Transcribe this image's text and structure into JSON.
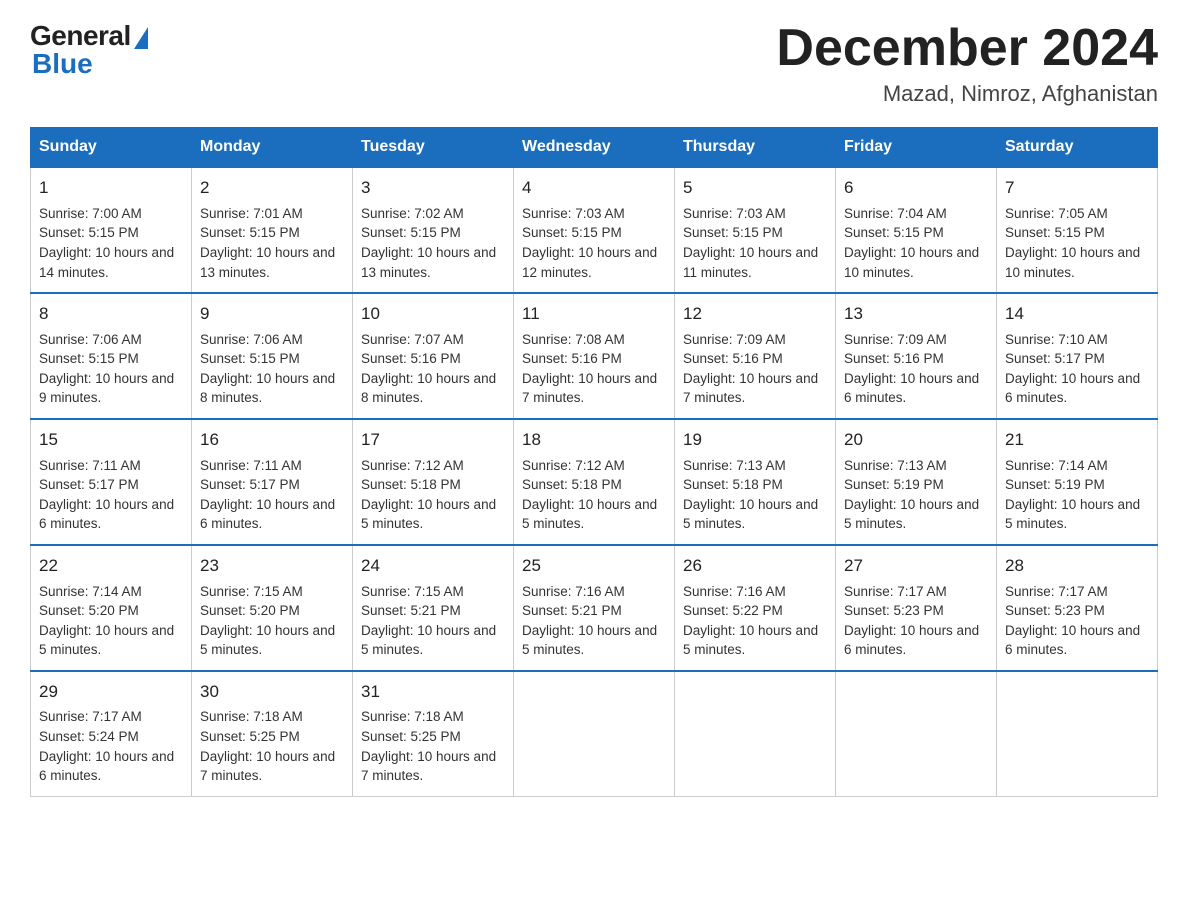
{
  "header": {
    "logo_general": "General",
    "logo_blue": "Blue",
    "title": "December 2024",
    "location": "Mazad, Nimroz, Afghanistan"
  },
  "days_of_week": [
    "Sunday",
    "Monday",
    "Tuesday",
    "Wednesday",
    "Thursday",
    "Friday",
    "Saturday"
  ],
  "weeks": [
    [
      {
        "day": "1",
        "sunrise": "7:00 AM",
        "sunset": "5:15 PM",
        "daylight": "10 hours and 14 minutes."
      },
      {
        "day": "2",
        "sunrise": "7:01 AM",
        "sunset": "5:15 PM",
        "daylight": "10 hours and 13 minutes."
      },
      {
        "day": "3",
        "sunrise": "7:02 AM",
        "sunset": "5:15 PM",
        "daylight": "10 hours and 13 minutes."
      },
      {
        "day": "4",
        "sunrise": "7:03 AM",
        "sunset": "5:15 PM",
        "daylight": "10 hours and 12 minutes."
      },
      {
        "day": "5",
        "sunrise": "7:03 AM",
        "sunset": "5:15 PM",
        "daylight": "10 hours and 11 minutes."
      },
      {
        "day": "6",
        "sunrise": "7:04 AM",
        "sunset": "5:15 PM",
        "daylight": "10 hours and 10 minutes."
      },
      {
        "day": "7",
        "sunrise": "7:05 AM",
        "sunset": "5:15 PM",
        "daylight": "10 hours and 10 minutes."
      }
    ],
    [
      {
        "day": "8",
        "sunrise": "7:06 AM",
        "sunset": "5:15 PM",
        "daylight": "10 hours and 9 minutes."
      },
      {
        "day": "9",
        "sunrise": "7:06 AM",
        "sunset": "5:15 PM",
        "daylight": "10 hours and 8 minutes."
      },
      {
        "day": "10",
        "sunrise": "7:07 AM",
        "sunset": "5:16 PM",
        "daylight": "10 hours and 8 minutes."
      },
      {
        "day": "11",
        "sunrise": "7:08 AM",
        "sunset": "5:16 PM",
        "daylight": "10 hours and 7 minutes."
      },
      {
        "day": "12",
        "sunrise": "7:09 AM",
        "sunset": "5:16 PM",
        "daylight": "10 hours and 7 minutes."
      },
      {
        "day": "13",
        "sunrise": "7:09 AM",
        "sunset": "5:16 PM",
        "daylight": "10 hours and 6 minutes."
      },
      {
        "day": "14",
        "sunrise": "7:10 AM",
        "sunset": "5:17 PM",
        "daylight": "10 hours and 6 minutes."
      }
    ],
    [
      {
        "day": "15",
        "sunrise": "7:11 AM",
        "sunset": "5:17 PM",
        "daylight": "10 hours and 6 minutes."
      },
      {
        "day": "16",
        "sunrise": "7:11 AM",
        "sunset": "5:17 PM",
        "daylight": "10 hours and 6 minutes."
      },
      {
        "day": "17",
        "sunrise": "7:12 AM",
        "sunset": "5:18 PM",
        "daylight": "10 hours and 5 minutes."
      },
      {
        "day": "18",
        "sunrise": "7:12 AM",
        "sunset": "5:18 PM",
        "daylight": "10 hours and 5 minutes."
      },
      {
        "day": "19",
        "sunrise": "7:13 AM",
        "sunset": "5:18 PM",
        "daylight": "10 hours and 5 minutes."
      },
      {
        "day": "20",
        "sunrise": "7:13 AM",
        "sunset": "5:19 PM",
        "daylight": "10 hours and 5 minutes."
      },
      {
        "day": "21",
        "sunrise": "7:14 AM",
        "sunset": "5:19 PM",
        "daylight": "10 hours and 5 minutes."
      }
    ],
    [
      {
        "day": "22",
        "sunrise": "7:14 AM",
        "sunset": "5:20 PM",
        "daylight": "10 hours and 5 minutes."
      },
      {
        "day": "23",
        "sunrise": "7:15 AM",
        "sunset": "5:20 PM",
        "daylight": "10 hours and 5 minutes."
      },
      {
        "day": "24",
        "sunrise": "7:15 AM",
        "sunset": "5:21 PM",
        "daylight": "10 hours and 5 minutes."
      },
      {
        "day": "25",
        "sunrise": "7:16 AM",
        "sunset": "5:21 PM",
        "daylight": "10 hours and 5 minutes."
      },
      {
        "day": "26",
        "sunrise": "7:16 AM",
        "sunset": "5:22 PM",
        "daylight": "10 hours and 5 minutes."
      },
      {
        "day": "27",
        "sunrise": "7:17 AM",
        "sunset": "5:23 PM",
        "daylight": "10 hours and 6 minutes."
      },
      {
        "day": "28",
        "sunrise": "7:17 AM",
        "sunset": "5:23 PM",
        "daylight": "10 hours and 6 minutes."
      }
    ],
    [
      {
        "day": "29",
        "sunrise": "7:17 AM",
        "sunset": "5:24 PM",
        "daylight": "10 hours and 6 minutes."
      },
      {
        "day": "30",
        "sunrise": "7:18 AM",
        "sunset": "5:25 PM",
        "daylight": "10 hours and 7 minutes."
      },
      {
        "day": "31",
        "sunrise": "7:18 AM",
        "sunset": "5:25 PM",
        "daylight": "10 hours and 7 minutes."
      },
      null,
      null,
      null,
      null
    ]
  ]
}
